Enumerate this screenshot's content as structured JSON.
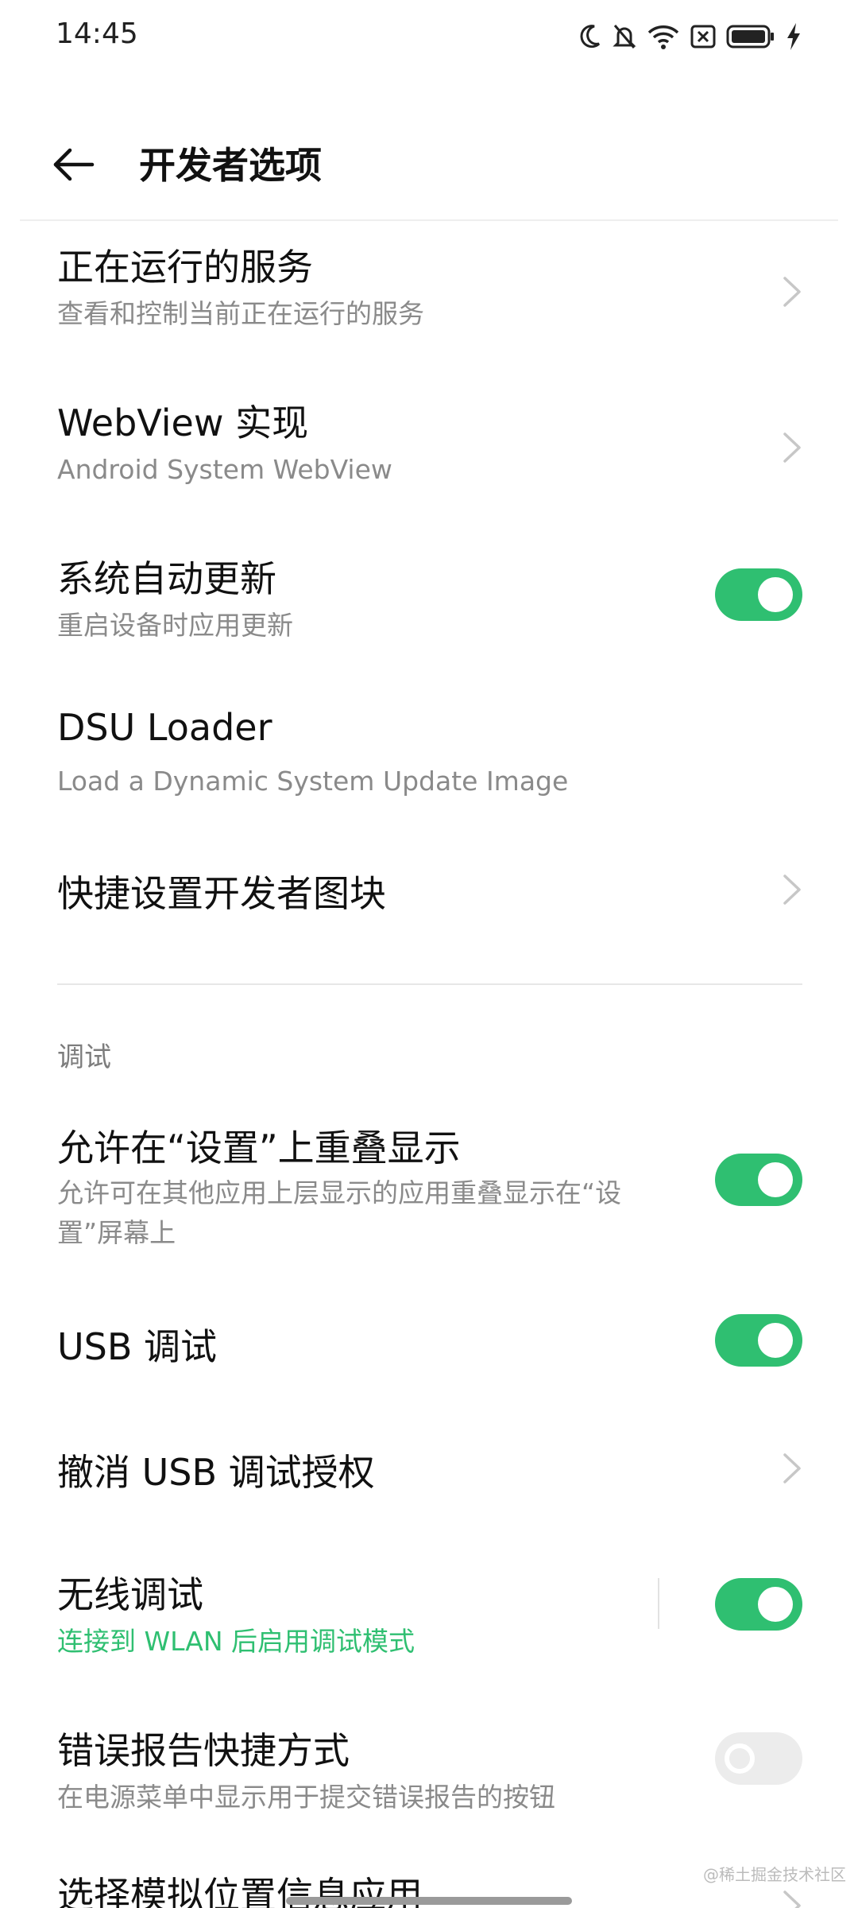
{
  "status_bar": {
    "time": "14:45",
    "icons": [
      "moon-icon",
      "bell-off-icon",
      "wifi-icon",
      "sim-card-x-icon",
      "battery-icon",
      "charging-bolt-icon"
    ]
  },
  "app_bar": {
    "title": "开发者选项",
    "back_icon": "arrow-left-icon"
  },
  "items": [
    {
      "title": "正在运行的服务",
      "subtitle": "查看和控制当前正在运行的服务",
      "control": "chevron"
    },
    {
      "title": "WebView 实现",
      "subtitle": "Android System WebView",
      "control": "chevron"
    },
    {
      "title": "系统自动更新",
      "subtitle": "重启设备时应用更新",
      "control": "toggle",
      "checked": true
    },
    {
      "title": "DSU Loader",
      "subtitle": "Load a Dynamic System Update Image",
      "control": "none"
    },
    {
      "title": "快捷设置开发者图块",
      "control": "chevron"
    }
  ],
  "section_debug": {
    "header": "调试",
    "items": [
      {
        "title": "允许在“设置”上重叠显示",
        "subtitle": "允许可在其他应用上层显示的应用重叠显示在“设置”屏幕上",
        "control": "toggle",
        "checked": true
      },
      {
        "title": "USB 调试",
        "control": "toggle",
        "checked": true
      },
      {
        "title": "撤消 USB 调试授权",
        "control": "chevron"
      },
      {
        "title": "无线调试",
        "subtitle": "连接到 WLAN 后启用调试模式",
        "subtitle_color": "#2fbf71",
        "control": "toggle",
        "checked": true
      },
      {
        "title": "错误报告快捷方式",
        "subtitle": "在电源菜单中显示用于提交错误报告的按钮",
        "control": "toggle",
        "checked": false
      },
      {
        "title": "选择模拟位置信息应用",
        "control": "chevron"
      }
    ]
  },
  "watermark": "@稀土掘金技术社区",
  "colors": {
    "accent": "#2fbf71",
    "toggle_off": "#ececec"
  }
}
